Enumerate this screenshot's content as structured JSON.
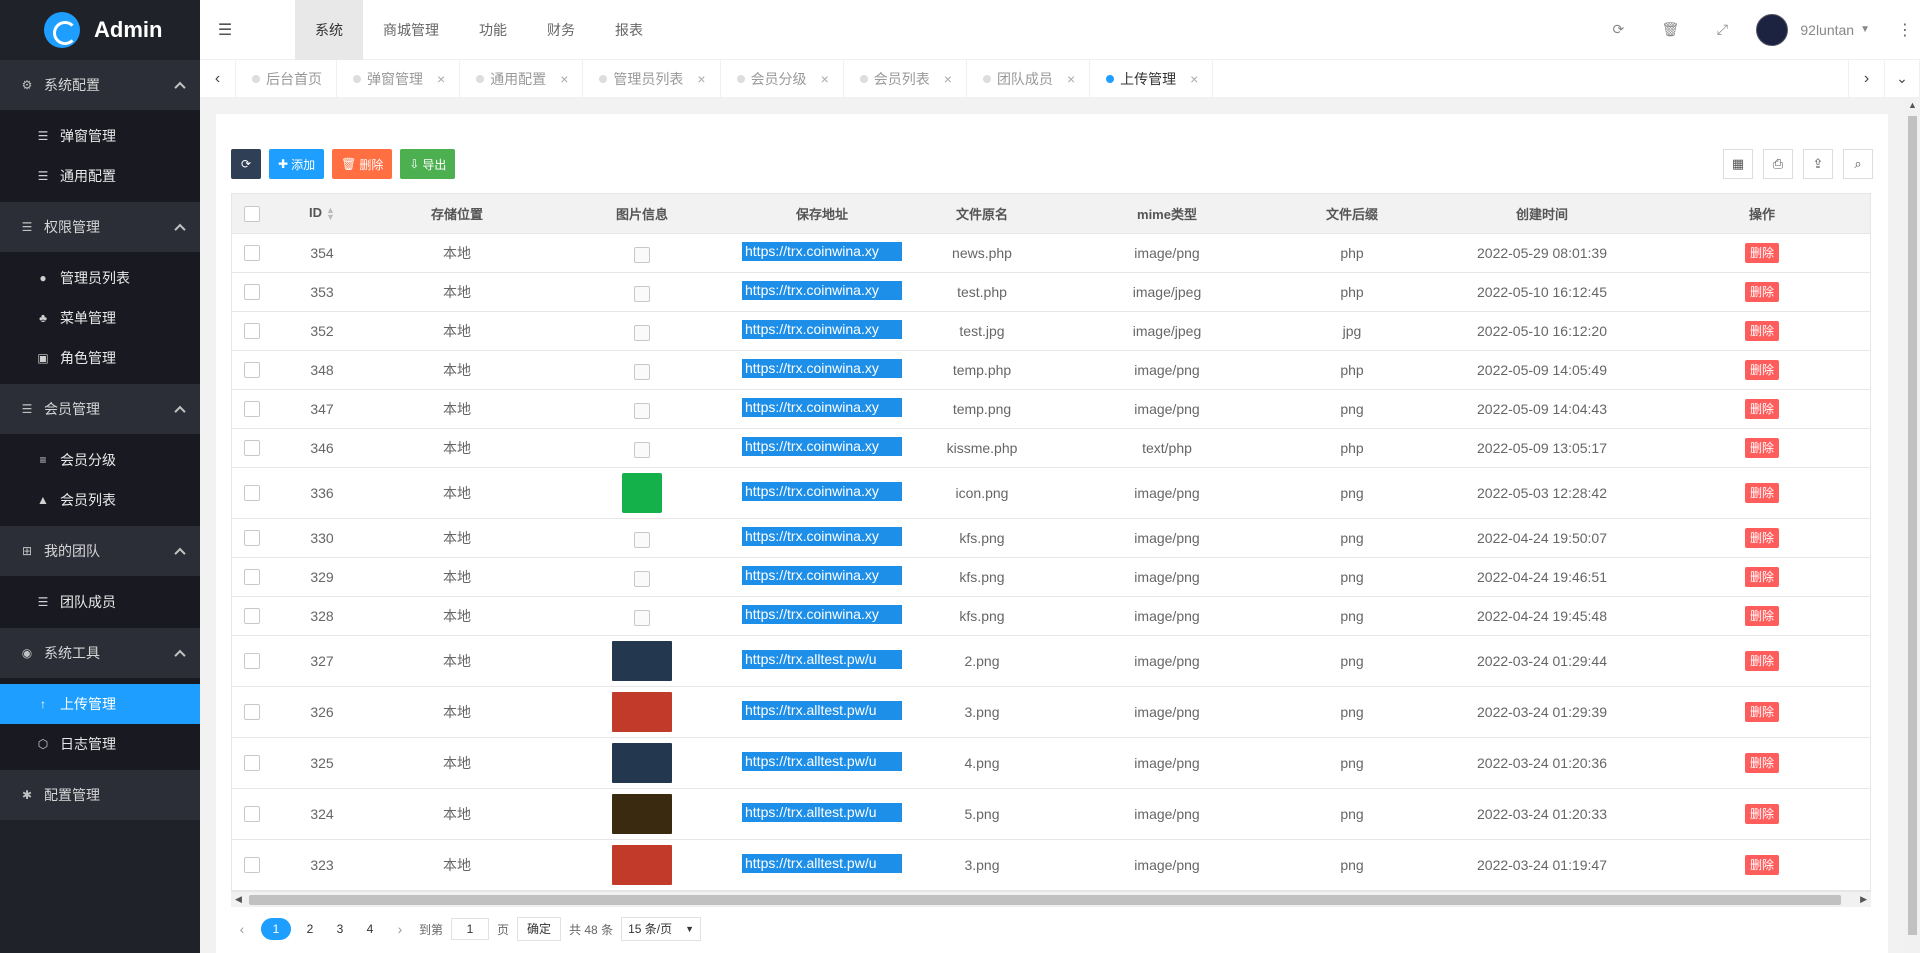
{
  "app": {
    "title": "Admin"
  },
  "sidebar": {
    "groups": [
      {
        "title": "系统配置",
        "icon": "gears-icon",
        "items": [
          {
            "label": "弹窗管理",
            "icon": "list-icon"
          },
          {
            "label": "通用配置",
            "icon": "list-icon"
          }
        ]
      },
      {
        "title": "权限管理",
        "icon": "list-icon",
        "items": [
          {
            "label": "管理员列表",
            "icon": "user-icon"
          },
          {
            "label": "菜单管理",
            "icon": "tree-icon"
          },
          {
            "label": "角色管理",
            "icon": "id-card-icon"
          }
        ]
      },
      {
        "title": "会员管理",
        "icon": "list-icon",
        "items": [
          {
            "label": "会员分级",
            "icon": "align-left-icon"
          },
          {
            "label": "会员列表",
            "icon": "graduation-cap-icon"
          }
        ]
      },
      {
        "title": "我的团队",
        "icon": "sitemap-icon",
        "items": [
          {
            "label": "团队成员",
            "icon": "list-icon"
          }
        ]
      },
      {
        "title": "系统工具",
        "icon": "compass-icon",
        "items": [
          {
            "label": "上传管理",
            "icon": "arrow-up-icon",
            "active": true
          },
          {
            "label": "日志管理",
            "icon": "cube-icon"
          }
        ]
      },
      {
        "title": "配置管理",
        "icon": "asterisk-icon",
        "items": []
      }
    ]
  },
  "header": {
    "nav": [
      "系统",
      "商城管理",
      "功能",
      "财务",
      "报表"
    ],
    "active_nav": "系统",
    "username": "92luntan"
  },
  "tabs": [
    {
      "label": "后台首页"
    },
    {
      "label": "弹窗管理"
    },
    {
      "label": "通用配置"
    },
    {
      "label": "管理员列表"
    },
    {
      "label": "会员分级"
    },
    {
      "label": "会员列表"
    },
    {
      "label": "团队成员"
    },
    {
      "label": "上传管理",
      "active": true
    }
  ],
  "toolbar": {
    "add": "添加",
    "delete": "删除",
    "export": "导出"
  },
  "table": {
    "columns": [
      "ID",
      "存储位置",
      "图片信息",
      "保存地址",
      "文件原名",
      "mime类型",
      "文件后缀",
      "创建时间",
      "操作"
    ],
    "rows": [
      {
        "id": "354",
        "storage": "本地",
        "image": "broken",
        "url": "https://trx.coinwina.xy",
        "name": "news.php",
        "mime": "image/png",
        "ext": "php",
        "time": "2022-05-29 08:01:39"
      },
      {
        "id": "353",
        "storage": "本地",
        "image": "broken",
        "url": "https://trx.coinwina.xy",
        "name": "test.php",
        "mime": "image/jpeg",
        "ext": "php",
        "time": "2022-05-10 16:12:45"
      },
      {
        "id": "352",
        "storage": "本地",
        "image": "broken",
        "url": "https://trx.coinwina.xy",
        "name": "test.jpg",
        "mime": "image/jpeg",
        "ext": "jpg",
        "time": "2022-05-10 16:12:20"
      },
      {
        "id": "348",
        "storage": "本地",
        "image": "broken",
        "url": "https://trx.coinwina.xy",
        "name": "temp.php",
        "mime": "image/png",
        "ext": "php",
        "time": "2022-05-09 14:05:49"
      },
      {
        "id": "347",
        "storage": "本地",
        "image": "broken",
        "url": "https://trx.coinwina.xy",
        "name": "temp.png",
        "mime": "image/png",
        "ext": "png",
        "time": "2022-05-09 14:04:43"
      },
      {
        "id": "346",
        "storage": "本地",
        "image": "broken",
        "url": "https://trx.coinwina.xy",
        "name": "kissme.php",
        "mime": "text/php",
        "ext": "php",
        "time": "2022-05-09 13:05:17"
      },
      {
        "id": "336",
        "storage": "本地",
        "image": "green",
        "url": "https://trx.coinwina.xy",
        "name": "icon.png",
        "mime": "image/png",
        "ext": "png",
        "time": "2022-05-03 12:28:42"
      },
      {
        "id": "330",
        "storage": "本地",
        "image": "broken",
        "url": "https://trx.coinwina.xy",
        "name": "kfs.png",
        "mime": "image/png",
        "ext": "png",
        "time": "2022-04-24 19:50:07"
      },
      {
        "id": "329",
        "storage": "本地",
        "image": "broken",
        "url": "https://trx.coinwina.xy",
        "name": "kfs.png",
        "mime": "image/png",
        "ext": "png",
        "time": "2022-04-24 19:46:51"
      },
      {
        "id": "328",
        "storage": "本地",
        "image": "broken",
        "url": "https://trx.coinwina.xy",
        "name": "kfs.png",
        "mime": "image/png",
        "ext": "png",
        "time": "2022-04-24 19:45:48"
      },
      {
        "id": "327",
        "storage": "本地",
        "image": "blue",
        "url": "https://trx.alltest.pw/u",
        "name": "2.png",
        "mime": "image/png",
        "ext": "png",
        "time": "2022-03-24 01:29:44"
      },
      {
        "id": "326",
        "storage": "本地",
        "image": "red",
        "url": "https://trx.alltest.pw/u",
        "name": "3.png",
        "mime": "image/png",
        "ext": "png",
        "time": "2022-03-24 01:29:39"
      },
      {
        "id": "325",
        "storage": "本地",
        "image": "blue",
        "url": "https://trx.alltest.pw/u",
        "name": "4.png",
        "mime": "image/png",
        "ext": "png",
        "time": "2022-03-24 01:20:36"
      },
      {
        "id": "324",
        "storage": "本地",
        "image": "gold",
        "url": "https://trx.alltest.pw/u",
        "name": "5.png",
        "mime": "image/png",
        "ext": "png",
        "time": "2022-03-24 01:20:33"
      },
      {
        "id": "323",
        "storage": "本地",
        "image": "red",
        "url": "https://trx.alltest.pw/u",
        "name": "3.png",
        "mime": "image/png",
        "ext": "png",
        "time": "2022-03-24 01:19:47"
      }
    ],
    "row_action": "删除"
  },
  "pager": {
    "pages": [
      "1",
      "2",
      "3",
      "4"
    ],
    "current": "1",
    "goto_label": "到第",
    "goto_value": "1",
    "page_unit": "页",
    "confirm": "确定",
    "total": "共 48 条",
    "page_size": "15 条/页"
  },
  "colors": {
    "accent": "#1e9fff",
    "sidebar_bg": "#20222a",
    "danger": "#ff5c5c"
  }
}
